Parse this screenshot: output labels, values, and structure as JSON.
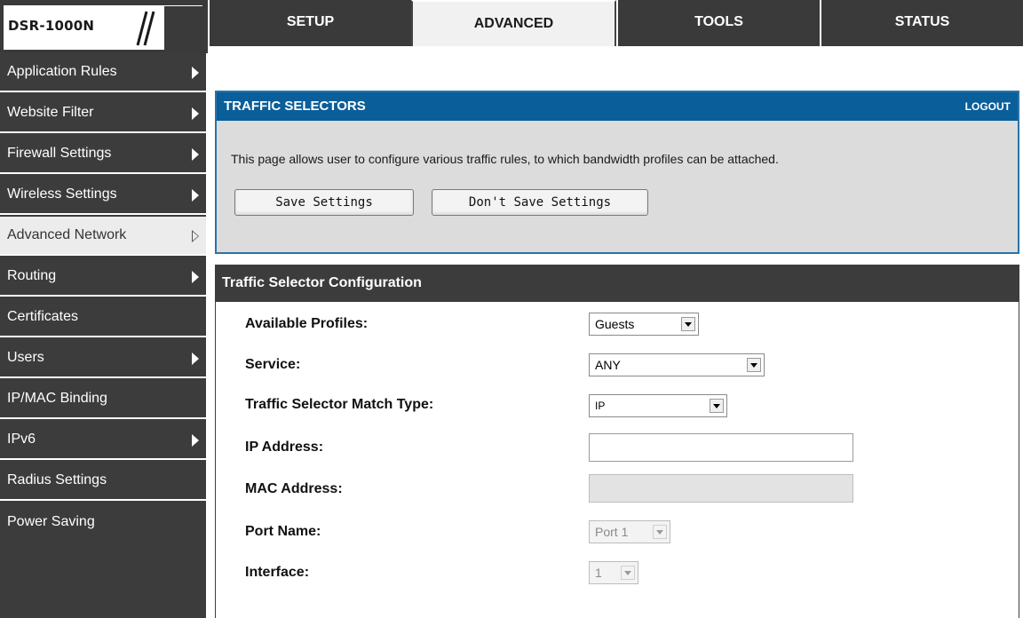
{
  "brand": {
    "label": "DSR-1000N"
  },
  "nav": {
    "tabs": [
      {
        "label": "SETUP"
      },
      {
        "label": "ADVANCED"
      },
      {
        "label": "TOOLS"
      },
      {
        "label": "STATUS"
      }
    ],
    "active": "ADVANCED"
  },
  "sidebar": {
    "items": [
      {
        "label": "Application Rules",
        "arrow": true
      },
      {
        "label": "Website Filter",
        "arrow": true
      },
      {
        "label": "Firewall Settings",
        "arrow": true
      },
      {
        "label": "Wireless Settings",
        "arrow": true
      },
      {
        "label": "Advanced Network",
        "arrow": true,
        "active": true
      },
      {
        "label": "Routing",
        "arrow": true
      },
      {
        "label": "Certificates",
        "arrow": false
      },
      {
        "label": "Users",
        "arrow": true
      },
      {
        "label": "IP/MAC Binding",
        "arrow": false
      },
      {
        "label": "IPv6",
        "arrow": true
      },
      {
        "label": "Radius Settings",
        "arrow": false
      },
      {
        "label": "Power Saving",
        "arrow": false
      }
    ]
  },
  "traffic_selectors": {
    "title": "TRAFFIC SELECTORS",
    "logout": "LOGOUT",
    "description": "This page allows user to configure various traffic rules, to which bandwidth profiles can be attached.",
    "save_label": "Save Settings",
    "dont_save_label": "Don't Save Settings"
  },
  "config": {
    "title": "Traffic Selector Configuration",
    "available_profiles": {
      "label": "Available Profiles:",
      "value": "Guests"
    },
    "service": {
      "label": "Service:",
      "value": "ANY"
    },
    "match_type": {
      "label": "Traffic Selector Match Type:",
      "value": "IP"
    },
    "ip_address": {
      "label": "IP Address:",
      "value": ""
    },
    "mac_address": {
      "label": "MAC Address:",
      "value": ""
    },
    "port_name": {
      "label": "Port Name:",
      "value": "Port 1"
    },
    "interface": {
      "label": "Interface:",
      "value": "1"
    }
  },
  "colors": {
    "header_blue": "#0a5e9a",
    "dark_gray": "#3c3c3c",
    "panel_gray": "#dcdcdc"
  }
}
